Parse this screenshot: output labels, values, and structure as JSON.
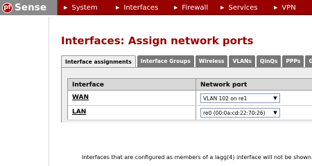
{
  "brand": {
    "logo_text": "Sense",
    "logo_mark": "pf"
  },
  "nav": {
    "items": [
      {
        "label": "System"
      },
      {
        "label": "Interfaces"
      },
      {
        "label": "Firewall"
      },
      {
        "label": "Services"
      },
      {
        "label": "VPN"
      }
    ]
  },
  "page": {
    "title": "Interfaces: Assign network ports"
  },
  "tabs": [
    {
      "label": "Interface assignments",
      "active": true
    },
    {
      "label": "Interface Groups"
    },
    {
      "label": "Wireless"
    },
    {
      "label": "VLANs"
    },
    {
      "label": "QinQs"
    },
    {
      "label": "PPPs"
    },
    {
      "label": "GRE"
    }
  ],
  "table": {
    "headers": {
      "interface": "Interface",
      "network_port": "Network port"
    },
    "rows": [
      {
        "interface": "WAN",
        "port": "VLAN 102 on re1"
      },
      {
        "interface": "LAN",
        "port": "re0 (00:0a:cd:22:70:26)"
      }
    ]
  },
  "notice": "Interfaces that are configured as members of a lagg(4) interface will not be shown.",
  "colors": {
    "brand_red": "#990000",
    "tab_gray": "#777777",
    "panel_bg": "#eeeeee"
  },
  "icons": {
    "nav_arrow": "triangle-right-icon",
    "select_caret": "caret-down-icon"
  }
}
